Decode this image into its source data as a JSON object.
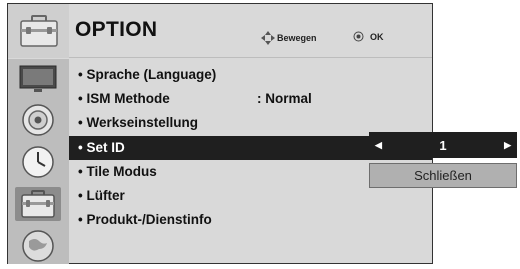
{
  "header": {
    "title": "OPTION",
    "icon": "briefcase-icon",
    "nav_hint": {
      "icon": "four-way-arrows-icon",
      "label": "Bewegen"
    },
    "ok_hint": {
      "icon": "ok-circle-icon",
      "label": "OK"
    }
  },
  "sidebar": {
    "icons": [
      "tv-screen-icon",
      "speaker-icon",
      "clock-icon",
      "briefcase-icon",
      "globe-icon"
    ],
    "selected_index": 3
  },
  "menu": {
    "items": [
      {
        "label": "• Sprache (Language)"
      },
      {
        "label": "• ISM Methode",
        "value": ": Normal"
      },
      {
        "label": "• Werkseinstellung"
      },
      {
        "label": "• Set ID"
      },
      {
        "label": "• Tile Modus"
      },
      {
        "label": "• Lüfter"
      },
      {
        "label": "• Produkt-/Dienstinfo"
      }
    ],
    "selected_index": 3
  },
  "popup": {
    "left_arrow": "◀",
    "value": "1",
    "right_arrow": "▶",
    "close_label": "Schließen"
  },
  "colors": {
    "selection": "#1f1f1f",
    "panel": "#d9d9d9",
    "sidebar": "#bdbdbd"
  }
}
